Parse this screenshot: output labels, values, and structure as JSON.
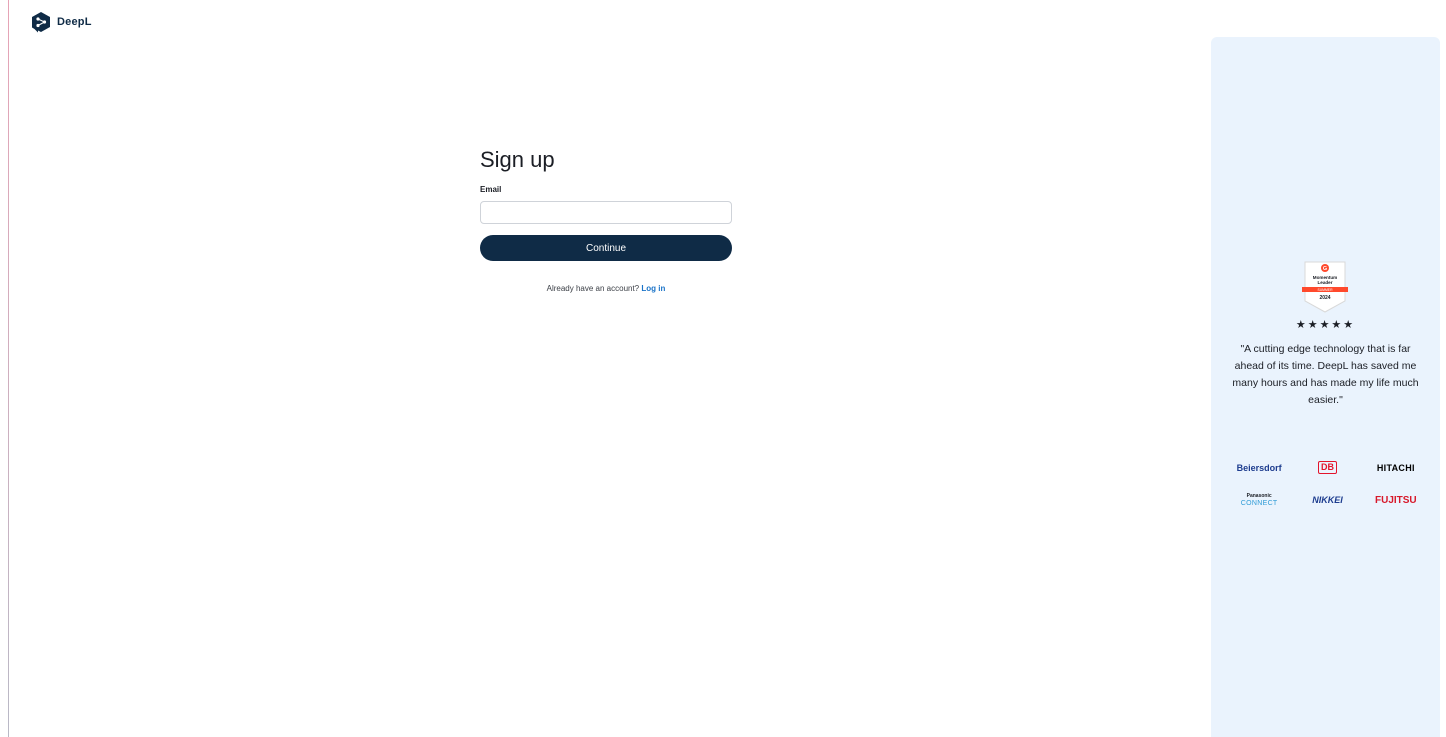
{
  "brand": {
    "name": "DeepL",
    "logo_icon": "deepl-logo-icon"
  },
  "signup": {
    "title": "Sign up",
    "email_label": "Email",
    "email_value": "",
    "email_placeholder": "",
    "continue_label": "Continue",
    "login_prompt": "Already have an account?",
    "login_link": "Log in"
  },
  "side_panel": {
    "badge": {
      "icon": "g2-momentum-leader-badge",
      "brand": "G",
      "line1": "Momentum",
      "line2": "Leader",
      "ribbon": "SUMMER",
      "year": "2024"
    },
    "rating": "★★★★★",
    "quote": "\"A cutting edge technology that is far ahead of its time. DeepL has saved me many hours and has made my life much easier.\"",
    "logos": [
      "Beiersdorf",
      "DB",
      "HITACHI",
      "Panasonic",
      "CONNECT",
      "NIKKEI",
      "FUJITSU"
    ]
  },
  "colors": {
    "accent": "#0f2b46",
    "link": "#1a73c8",
    "panel_bg": "#eaf3fd"
  }
}
